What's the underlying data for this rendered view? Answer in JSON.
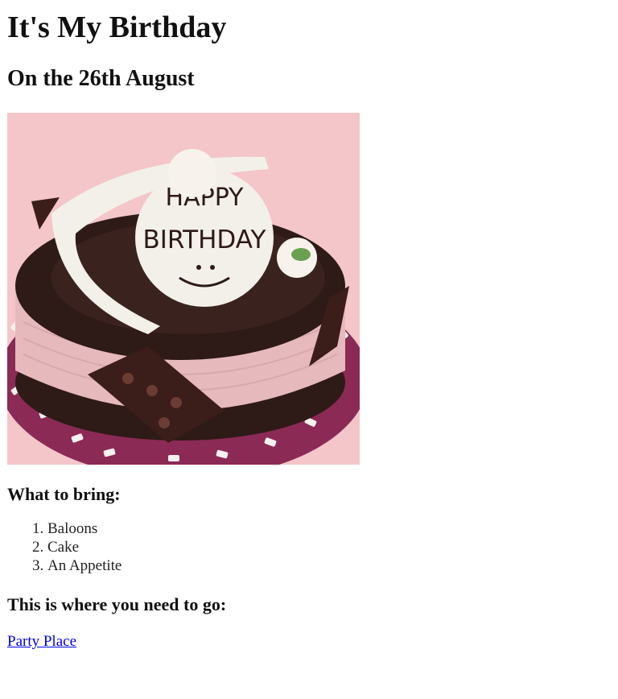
{
  "page": {
    "title": "It's My Birthday",
    "subtitle": "On the 26th August"
  },
  "image": {
    "alt": "Chocolate birthday cake with Happy Birthday topper",
    "icon": "birthday-cake-image",
    "topper_text_line1": "HAPPY",
    "topper_text_line2": "BIRTHDAY",
    "colors": {
      "background": "#f4c6c9",
      "chocolate": "#2e1a17",
      "pink_side": "#e6b9bd",
      "plate": "#8b2a55",
      "white": "#f3f0ea"
    }
  },
  "bring": {
    "title": "What to bring:",
    "items": [
      "Baloons",
      "Cake",
      "An Appetite"
    ]
  },
  "go": {
    "title": "This is where you need to go:",
    "link_text": "Party Place"
  }
}
